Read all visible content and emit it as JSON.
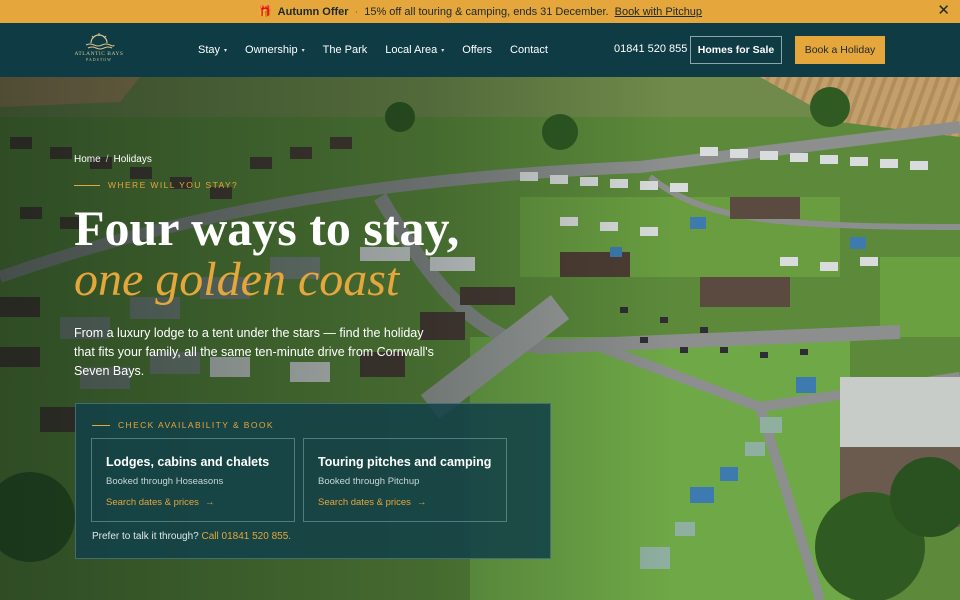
{
  "promo": {
    "gift_icon": "gift-icon",
    "title": "Autumn Offer",
    "separator": "·",
    "text": "15% off all touring & camping, ends 31 December.",
    "link": "Book with Pitchup",
    "close_icon": "close-icon"
  },
  "header": {
    "logo_line1": "ATLANTIC BAYS",
    "logo_line2": "PADSTOW",
    "nav": [
      {
        "label": "Stay",
        "has_menu": true
      },
      {
        "label": "Ownership",
        "has_menu": true
      },
      {
        "label": "The Park",
        "has_menu": false
      },
      {
        "label": "Local Area",
        "has_menu": true
      },
      {
        "label": "Offers",
        "has_menu": false
      },
      {
        "label": "Contact",
        "has_menu": false
      }
    ],
    "caret": "▾",
    "phone": "01841 520 855",
    "homes_button": "Homes for Sale",
    "book_button": "Book a Holiday"
  },
  "hero": {
    "breadcrumb": {
      "home": "Home",
      "divider": "/",
      "current": "Holidays"
    },
    "eyebrow": "WHERE WILL YOU STAY?",
    "heading_line1": "Four ways to stay,",
    "heading_line2": "one golden coast",
    "lede": "From a luxury lodge to a tent under the stars — find the holiday that fits your family, all the same ten-minute drive from Cornwall's Seven Bays."
  },
  "booking": {
    "eyebrow": "CHECK AVAILABILITY & BOOK",
    "options": [
      {
        "title": "Lodges, cabins and chalets",
        "subtitle": "Booked through Hoseasons",
        "link": "Search dates & prices",
        "arrow": "→"
      },
      {
        "title": "Touring pitches and camping",
        "subtitle": "Booked through Pitchup",
        "link": "Search dates & prices",
        "arrow": "→"
      }
    ],
    "footer_text": "Prefer to talk it through?",
    "footer_phone": "Call 01841 520 855."
  },
  "colors": {
    "accent": "#e5a63c",
    "header_bg": "#0f3b45",
    "card_bg": "#114048"
  }
}
